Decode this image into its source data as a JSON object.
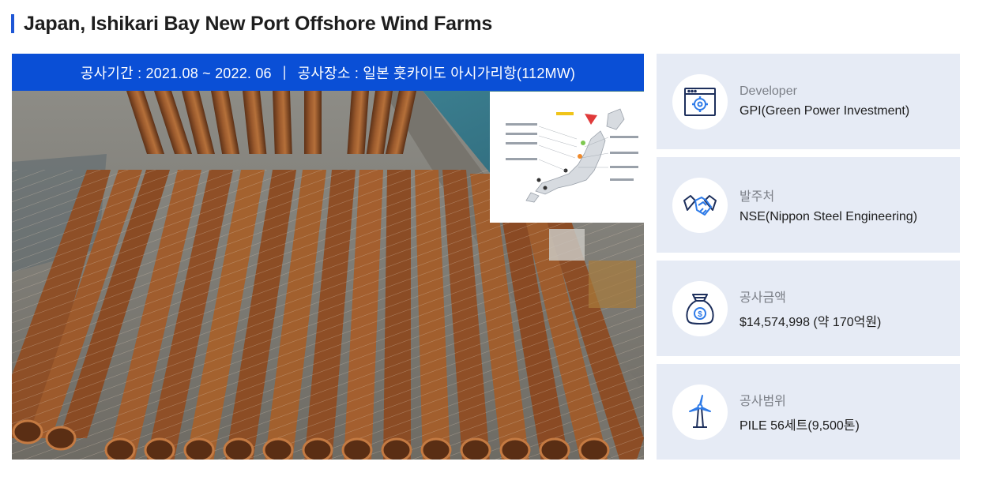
{
  "page": {
    "title": "Japan, Ishikari Bay New Port Offshore Wind Farms"
  },
  "banner": {
    "period": "공사기간 : 2021.08 ~ 2022. 06",
    "separator": "|",
    "location": "공사장소 : 일본 훗카이도 아시가리항(112MW)"
  },
  "cards": [
    {
      "icon": "settings-window-icon",
      "label": "Developer",
      "value": "GPI(Green Power Investment)"
    },
    {
      "icon": "handshake-icon",
      "label": "발주처",
      "value": "NSE(Nippon Steel Engineering)"
    },
    {
      "icon": "money-bag-icon",
      "label": "공사금액",
      "value": "$14,574,998 (약 170억원)"
    },
    {
      "icon": "wind-turbine-icon",
      "label": "공사범위",
      "value": "PILE 56세트(9,500톤)"
    }
  ],
  "colors": {
    "accent": "#0a4fd6",
    "card_bg": "#e6ebf5",
    "icon_stroke": "#1d2f5c",
    "icon_accent": "#2e7be8"
  }
}
